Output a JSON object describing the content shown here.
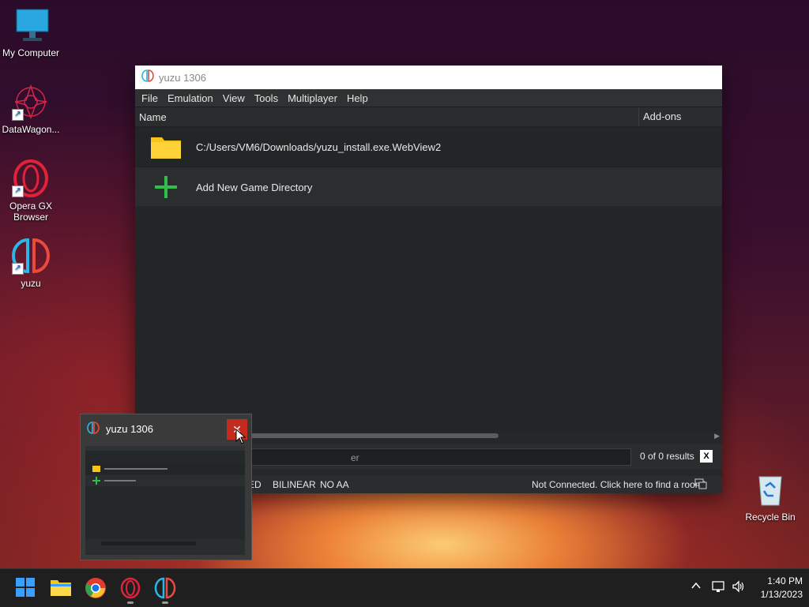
{
  "desktop": {
    "icons": [
      {
        "label": "My Computer"
      },
      {
        "label": "DataWagon..."
      },
      {
        "label": "Opera GX Browser"
      },
      {
        "label": "yuzu"
      },
      {
        "label": "Recycle Bin"
      }
    ]
  },
  "window": {
    "title": "yuzu 1306",
    "menu": [
      "File",
      "Emulation",
      "View",
      "Tools",
      "Multiplayer",
      "Help"
    ],
    "columns": {
      "name": "Name",
      "addons": "Add-ons"
    },
    "rows": [
      {
        "label": "C:/Users/VM6/Downloads/yuzu_install.exe.WebView2",
        "icon": "folder-icon"
      },
      {
        "label": "Add New Game Directory",
        "icon": "plus-icon"
      }
    ],
    "filter": {
      "placeholder_visible": "er",
      "results": "0 of 0 results",
      "clear_label": "X"
    },
    "status": {
      "left": "ED",
      "filter": "BILINEAR",
      "aa": "NO AA",
      "network": "Not Connected. Click here to find a room!"
    }
  },
  "preview": {
    "title": "yuzu 1306",
    "close_glyph": "✕"
  },
  "taskbar": {
    "time": "1:40 PM",
    "date": "1/13/2023"
  },
  "colors": {
    "window_bg": "#252829",
    "accent_green": "#2fbf4a",
    "folder_yellow": "#f5c518",
    "close_red": "#c42b1c"
  }
}
